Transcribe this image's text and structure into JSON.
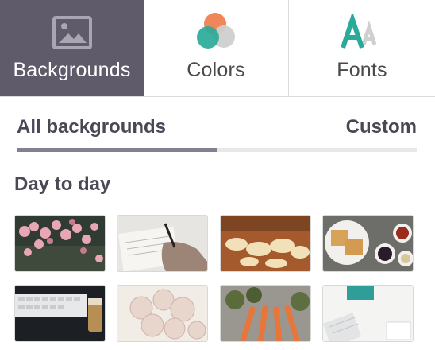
{
  "tabs": [
    {
      "label": "Backgrounds",
      "icon": "image-icon",
      "active": true
    },
    {
      "label": "Colors",
      "icon": "color-circles-icon",
      "active": false
    },
    {
      "label": "Fonts",
      "icon": "font-icon",
      "active": false
    }
  ],
  "subtabs": {
    "all_label": "All backgrounds",
    "custom_label": "Custom",
    "progress": 0.5
  },
  "section": {
    "title": "Day to day"
  },
  "colors": {
    "active_tab_bg": "#5f5b6a",
    "accent_orange": "#f0875a",
    "accent_teal": "#2aaa9a",
    "accent_gray": "#cfcfcf",
    "track_fill": "#858091"
  },
  "thumbnails": [
    {
      "name": "pink-orchids"
    },
    {
      "name": "hand-writing-notes"
    },
    {
      "name": "pasta-on-wood"
    },
    {
      "name": "waffles-and-berries"
    },
    {
      "name": "keyboard-and-drink"
    },
    {
      "name": "garlic-bulbs"
    },
    {
      "name": "carrots-and-artichokes"
    },
    {
      "name": "desk-keyboard-notebook"
    }
  ]
}
